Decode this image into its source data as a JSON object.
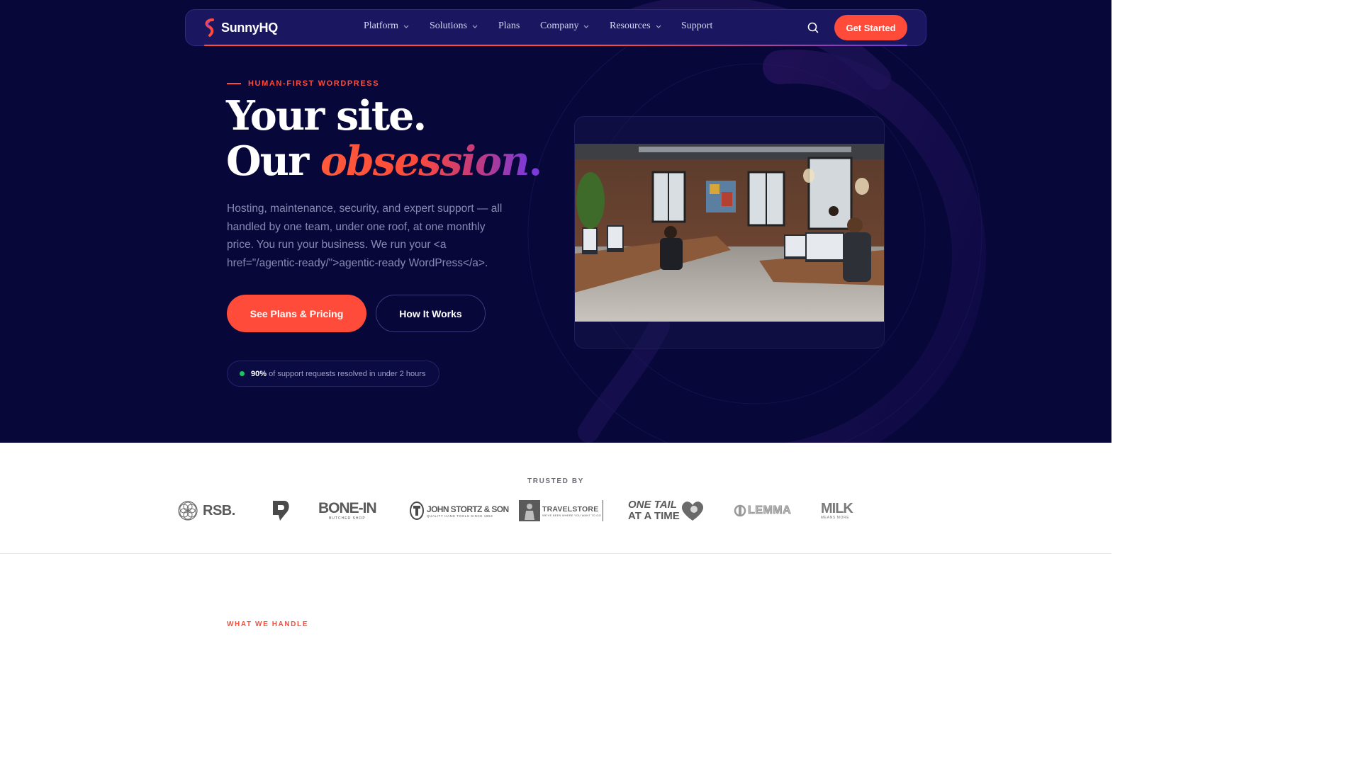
{
  "brand": {
    "name": "SunnyHQ",
    "accent": "#ff4b3a",
    "bg": "#07073a"
  },
  "nav": {
    "items": [
      {
        "label": "Platform",
        "dropdown": true
      },
      {
        "label": "Solutions",
        "dropdown": true
      },
      {
        "label": "Plans",
        "dropdown": false
      },
      {
        "label": "Company",
        "dropdown": true
      },
      {
        "label": "Resources",
        "dropdown": true
      },
      {
        "label": "Support",
        "dropdown": false
      }
    ],
    "search_icon": "search-icon",
    "cta_label": "Get Started"
  },
  "hero": {
    "eyebrow": "HUMAN-FIRST WORDPRESS",
    "headline_line1": "Your site.",
    "headline_line2_prefix": "Our ",
    "headline_accent": "obsession",
    "headline_dot": ".",
    "lede": "Hosting, maintenance, security, and expert support — all handled by one team, under one roof, at one monthly price. You run your business. We run your <a href=\"/agentic-ready/\">agentic-ready WordPress</a>.",
    "primary_cta": "See Plans & Pricing",
    "secondary_cta": "How It Works",
    "stat_value": "90%",
    "stat_text": " of support requests resolved in under 2 hours",
    "stat_color": "#22c25e"
  },
  "trusted": {
    "label": "TRUSTED BY",
    "logos": [
      {
        "name": "RSB.",
        "icon": "flower-of-life-icon"
      },
      {
        "name": "",
        "icon": "d-shield-icon"
      },
      {
        "name": "BONE-IN",
        "sub": "BUTCHER SHOP"
      },
      {
        "name": "JOHN STORTZ & SON",
        "sub": "QUALITY HAND TOOLS SINCE 1853"
      },
      {
        "name": "TRAVELSTORE",
        "sub": "WE'VE BEEN WHERE YOU WANT TO GO"
      },
      {
        "name_line1": "ONE TAIL",
        "name_line2": "AT A TIME"
      },
      {
        "name": "LEMMA"
      },
      {
        "name": "MILK",
        "sub": "MEANS MORE"
      }
    ]
  },
  "next_section": {
    "eyebrow": "WHAT WE HANDLE"
  }
}
